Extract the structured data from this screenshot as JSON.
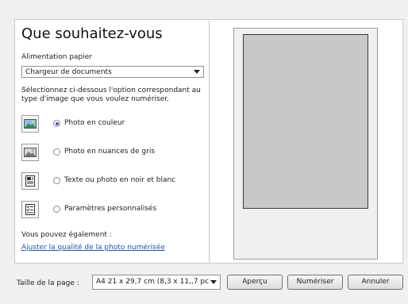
{
  "panel": {
    "title": "Que souhaitez-vous",
    "feed_label": "Alimentation papier",
    "feed_value": "Chargeur de documents",
    "description": "Sélectionnez ci-dessous l'option correspondant au type d'image que vous voulez numériser.",
    "options": [
      {
        "label": "Photo en couleur",
        "icon": "color-photo-icon",
        "selected": true
      },
      {
        "label": "Photo en nuances de gris",
        "icon": "grayscale-photo-icon",
        "selected": false
      },
      {
        "label": "Texte ou photo en noir et blanc",
        "icon": "bw-text-photo-icon",
        "selected": false
      },
      {
        "label": "Paramètres personnalisés",
        "icon": "custom-settings-icon",
        "selected": false
      }
    ],
    "also_label": "Vous pouvez également :",
    "adjust_link": "Ajuster la qualité de la photo numérisée"
  },
  "bottom": {
    "page_size_label": "Taille de la page :",
    "page_size_value": "A4 21 x 29,7 cm (8,3 x 11,,7 pc",
    "preview_button": "Aperçu",
    "scan_button": "Numériser",
    "cancel_button": "Annuler"
  },
  "colors": {
    "radio_selected": "#2d5ecf",
    "link": "#1b57b4",
    "preview_gray": "#c8c8c8"
  }
}
